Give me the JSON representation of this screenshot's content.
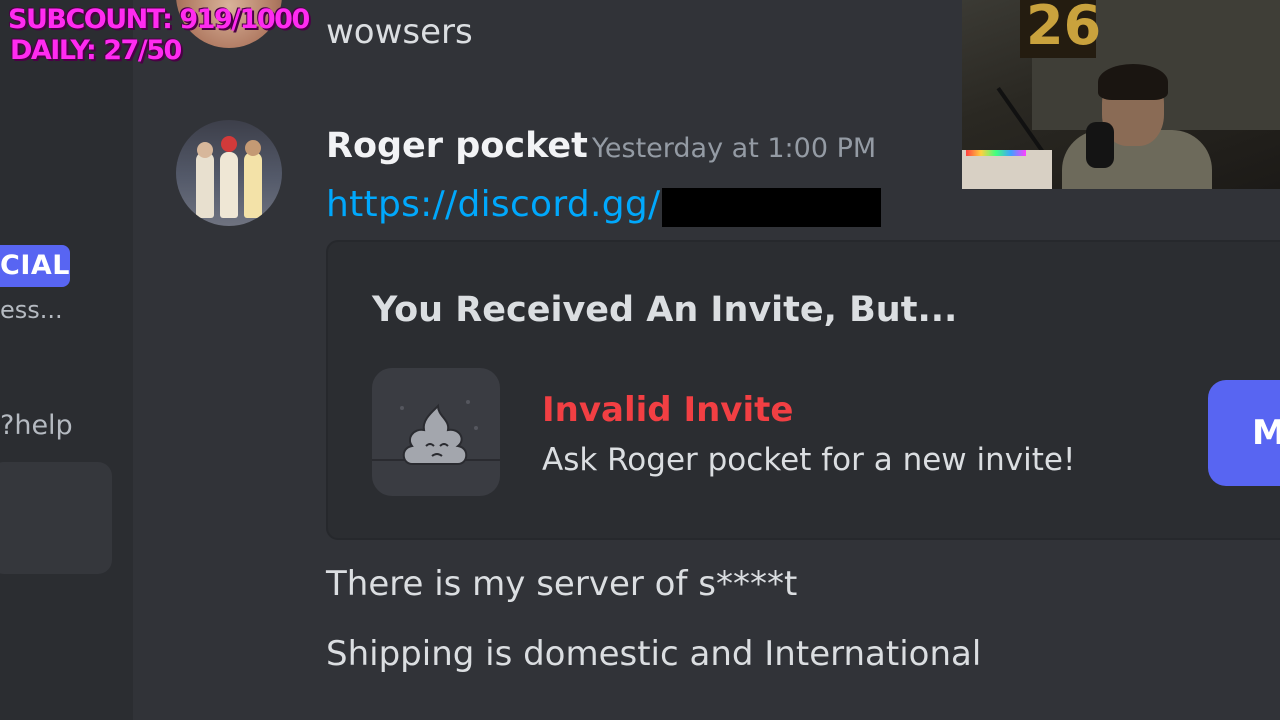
{
  "overlay": {
    "subcount": "SUBCOUNT: 919/1000",
    "daily": "DAILY: 27/50"
  },
  "sidebar": {
    "badge": "CIAL",
    "badge_subtext": "ess...",
    "help": "?help"
  },
  "messages": {
    "previous": "wowsers",
    "author": "Roger pocket",
    "timestamp": "Yesterday at 1:00 PM",
    "link": "https://discord.gg/",
    "embed": {
      "heading": "You Received An Invite, But...",
      "title": "Invalid Invite",
      "subtitle": "Ask Roger pocket for a new invite!",
      "button_label": "M"
    },
    "line1": "There is my server of s****t",
    "line2": "Shipping is domestic and International"
  },
  "webcam": {
    "number": "26"
  },
  "colors": {
    "background": "#313338",
    "sidebar": "#2b2d31",
    "link": "#00a8fc",
    "invalid": "#f23f43",
    "blurple": "#5865f2",
    "overlay_text": "#ff2bf0"
  }
}
